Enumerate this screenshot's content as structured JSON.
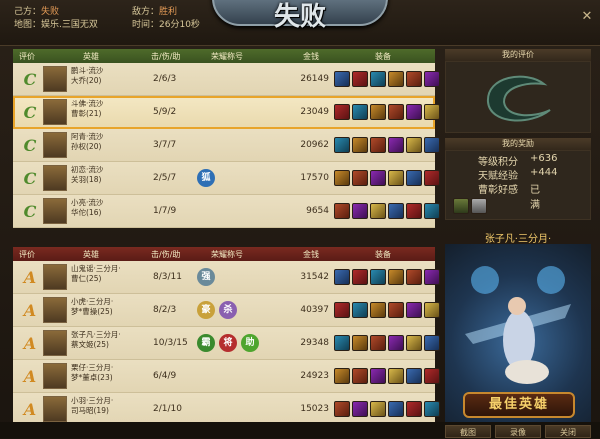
{
  "header": {
    "title": "失败",
    "own_side_label": "己方：",
    "own_side_value": "失败",
    "enemy_side_label": "敌方：",
    "enemy_side_value": "胜利",
    "map_label": "地图：",
    "map_value": "娱乐.三国无双",
    "time_label": "时间：",
    "time_value": "26分10秒"
  },
  "columns": {
    "rank": "评价",
    "hero": "英雄",
    "kda": "击/伤/助",
    "honor": "荣耀称号",
    "gold": "金钱",
    "equip": "装备"
  },
  "team_lose": [
    {
      "rank": "C",
      "name1": "鹏斗·流沙",
      "name2": "大乔(20)",
      "kda": "2/6/3",
      "gold": "26149",
      "badges": []
    },
    {
      "rank": "C",
      "name1": "斗佛·流沙",
      "name2": "曹彰(21)",
      "kda": "5/9/2",
      "gold": "23049",
      "badges": [],
      "selected": true
    },
    {
      "rank": "C",
      "name1": "阿青·流沙",
      "name2": "孙权(20)",
      "kda": "3/7/7",
      "gold": "20962",
      "badges": []
    },
    {
      "rank": "C",
      "name1": "初恋·流沙",
      "name2": "关羽(18)",
      "kda": "2/5/7",
      "gold": "17570",
      "badges": [
        {
          "text": "狐",
          "color": "#2e6fb5"
        }
      ]
    },
    {
      "rank": "C",
      "name1": "小亮·流沙",
      "name2": "华佗(16)",
      "kda": "1/7/9",
      "gold": "9654",
      "badges": []
    }
  ],
  "team_win": [
    {
      "rank": "A",
      "name1": "山鬼谣·三分月·",
      "name2": "曹仁(25)",
      "kda": "8/3/11",
      "gold": "31542",
      "badges": [
        {
          "text": "强",
          "color": "#6a8a9a"
        }
      ]
    },
    {
      "rank": "A",
      "name1": "小虎·三分月·",
      "name2": "梦*曹操(25)",
      "kda": "8/2/3",
      "gold": "40397",
      "badges": [
        {
          "text": "豪",
          "color": "#c9a13a"
        },
        {
          "text": "杀",
          "color": "#8a5fb0"
        }
      ]
    },
    {
      "rank": "A",
      "name1": "张子凡·三分月·",
      "name2": "蔡文姬(25)",
      "kda": "10/3/15",
      "gold": "29348",
      "badges": [
        {
          "text": "霸",
          "color": "#3a8a2e"
        },
        {
          "text": "将",
          "color": "#b52e2e"
        },
        {
          "text": "助",
          "color": "#4ea52e"
        }
      ]
    },
    {
      "rank": "A",
      "name1": "栗仔·三分月·",
      "name2": "梦*董卓(23)",
      "kda": "6/4/9",
      "gold": "24923",
      "badges": []
    },
    {
      "rank": "A",
      "name1": "小羽·三分月·",
      "name2": "司马昭(19)",
      "kda": "2/1/10",
      "gold": "15023",
      "badges": []
    }
  ],
  "right_panel": {
    "my_rating_title": "我的评价",
    "my_rating_grade": "C",
    "my_reward_title": "我的奖励",
    "rewards": [
      {
        "label": "等级积分",
        "value": "+636"
      },
      {
        "label": "天赋经验",
        "value": "+444"
      },
      {
        "label": "曹彰好感",
        "value": "已满"
      }
    ],
    "mvp_name": "张子凡·三分月·",
    "mvp_banner": "最佳英雄"
  },
  "buttons": {
    "screenshot": "截图",
    "replay": "录像",
    "close": "关闭"
  },
  "icons": {
    "close": "close-icon"
  },
  "colors": {
    "win_header": "#4e6b2a",
    "lose_header": "#7a2a20",
    "highlight": "#e8a42a",
    "rank_c": "#4f8a2c",
    "rank_a": "#d18a22"
  }
}
